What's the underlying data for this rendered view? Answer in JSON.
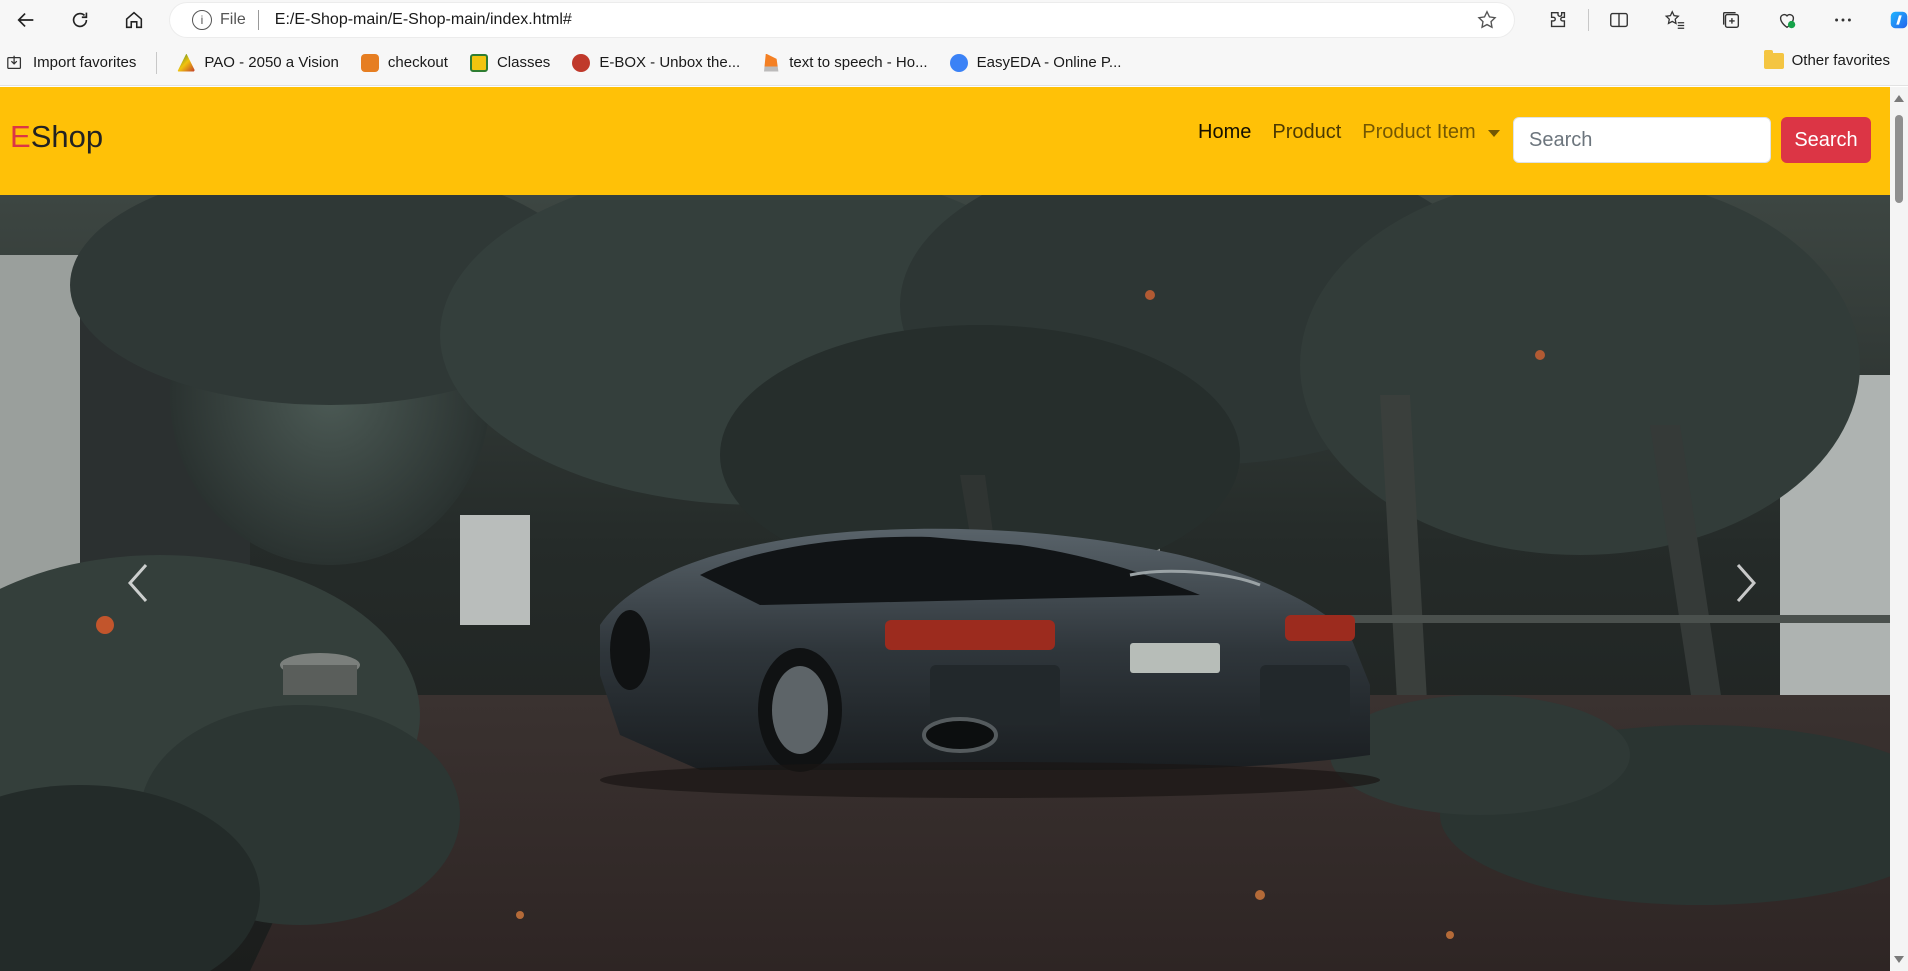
{
  "browser": {
    "address": {
      "scheme_label": "File",
      "url": "E:/E-Shop-main/E-Shop-main/index.html#"
    },
    "bookmarks": [
      {
        "label": "Import favorites",
        "icon": "import-icon"
      },
      {
        "label": "PAO - 2050 a Vision",
        "icon": "pao-icon",
        "color": "#c0392b"
      },
      {
        "label": "checkout",
        "icon": "checkout-icon",
        "color": "#e67e22"
      },
      {
        "label": "Classes",
        "icon": "classes-icon",
        "color": "#f1c40f"
      },
      {
        "label": "E-BOX - Unbox the...",
        "icon": "ebox-icon",
        "color": "#c0392b"
      },
      {
        "label": "text to speech - Ho...",
        "icon": "stackoverflow-icon",
        "color": "#f48024"
      },
      {
        "label": "EasyEDA - Online P...",
        "icon": "easyeda-icon",
        "color": "#3b82f6"
      }
    ],
    "other_favorites": "Other favorites"
  },
  "page": {
    "brand": {
      "first_letter": "E",
      "rest": "Shop"
    },
    "nav": {
      "home": "Home",
      "product": "Product",
      "product_item": "Product Item"
    },
    "search": {
      "placeholder": "Search",
      "button_label": "Search"
    },
    "colors": {
      "navbar": "#ffc107",
      "brand_accent": "#dc3545",
      "search_button": "#dc3545"
    }
  }
}
